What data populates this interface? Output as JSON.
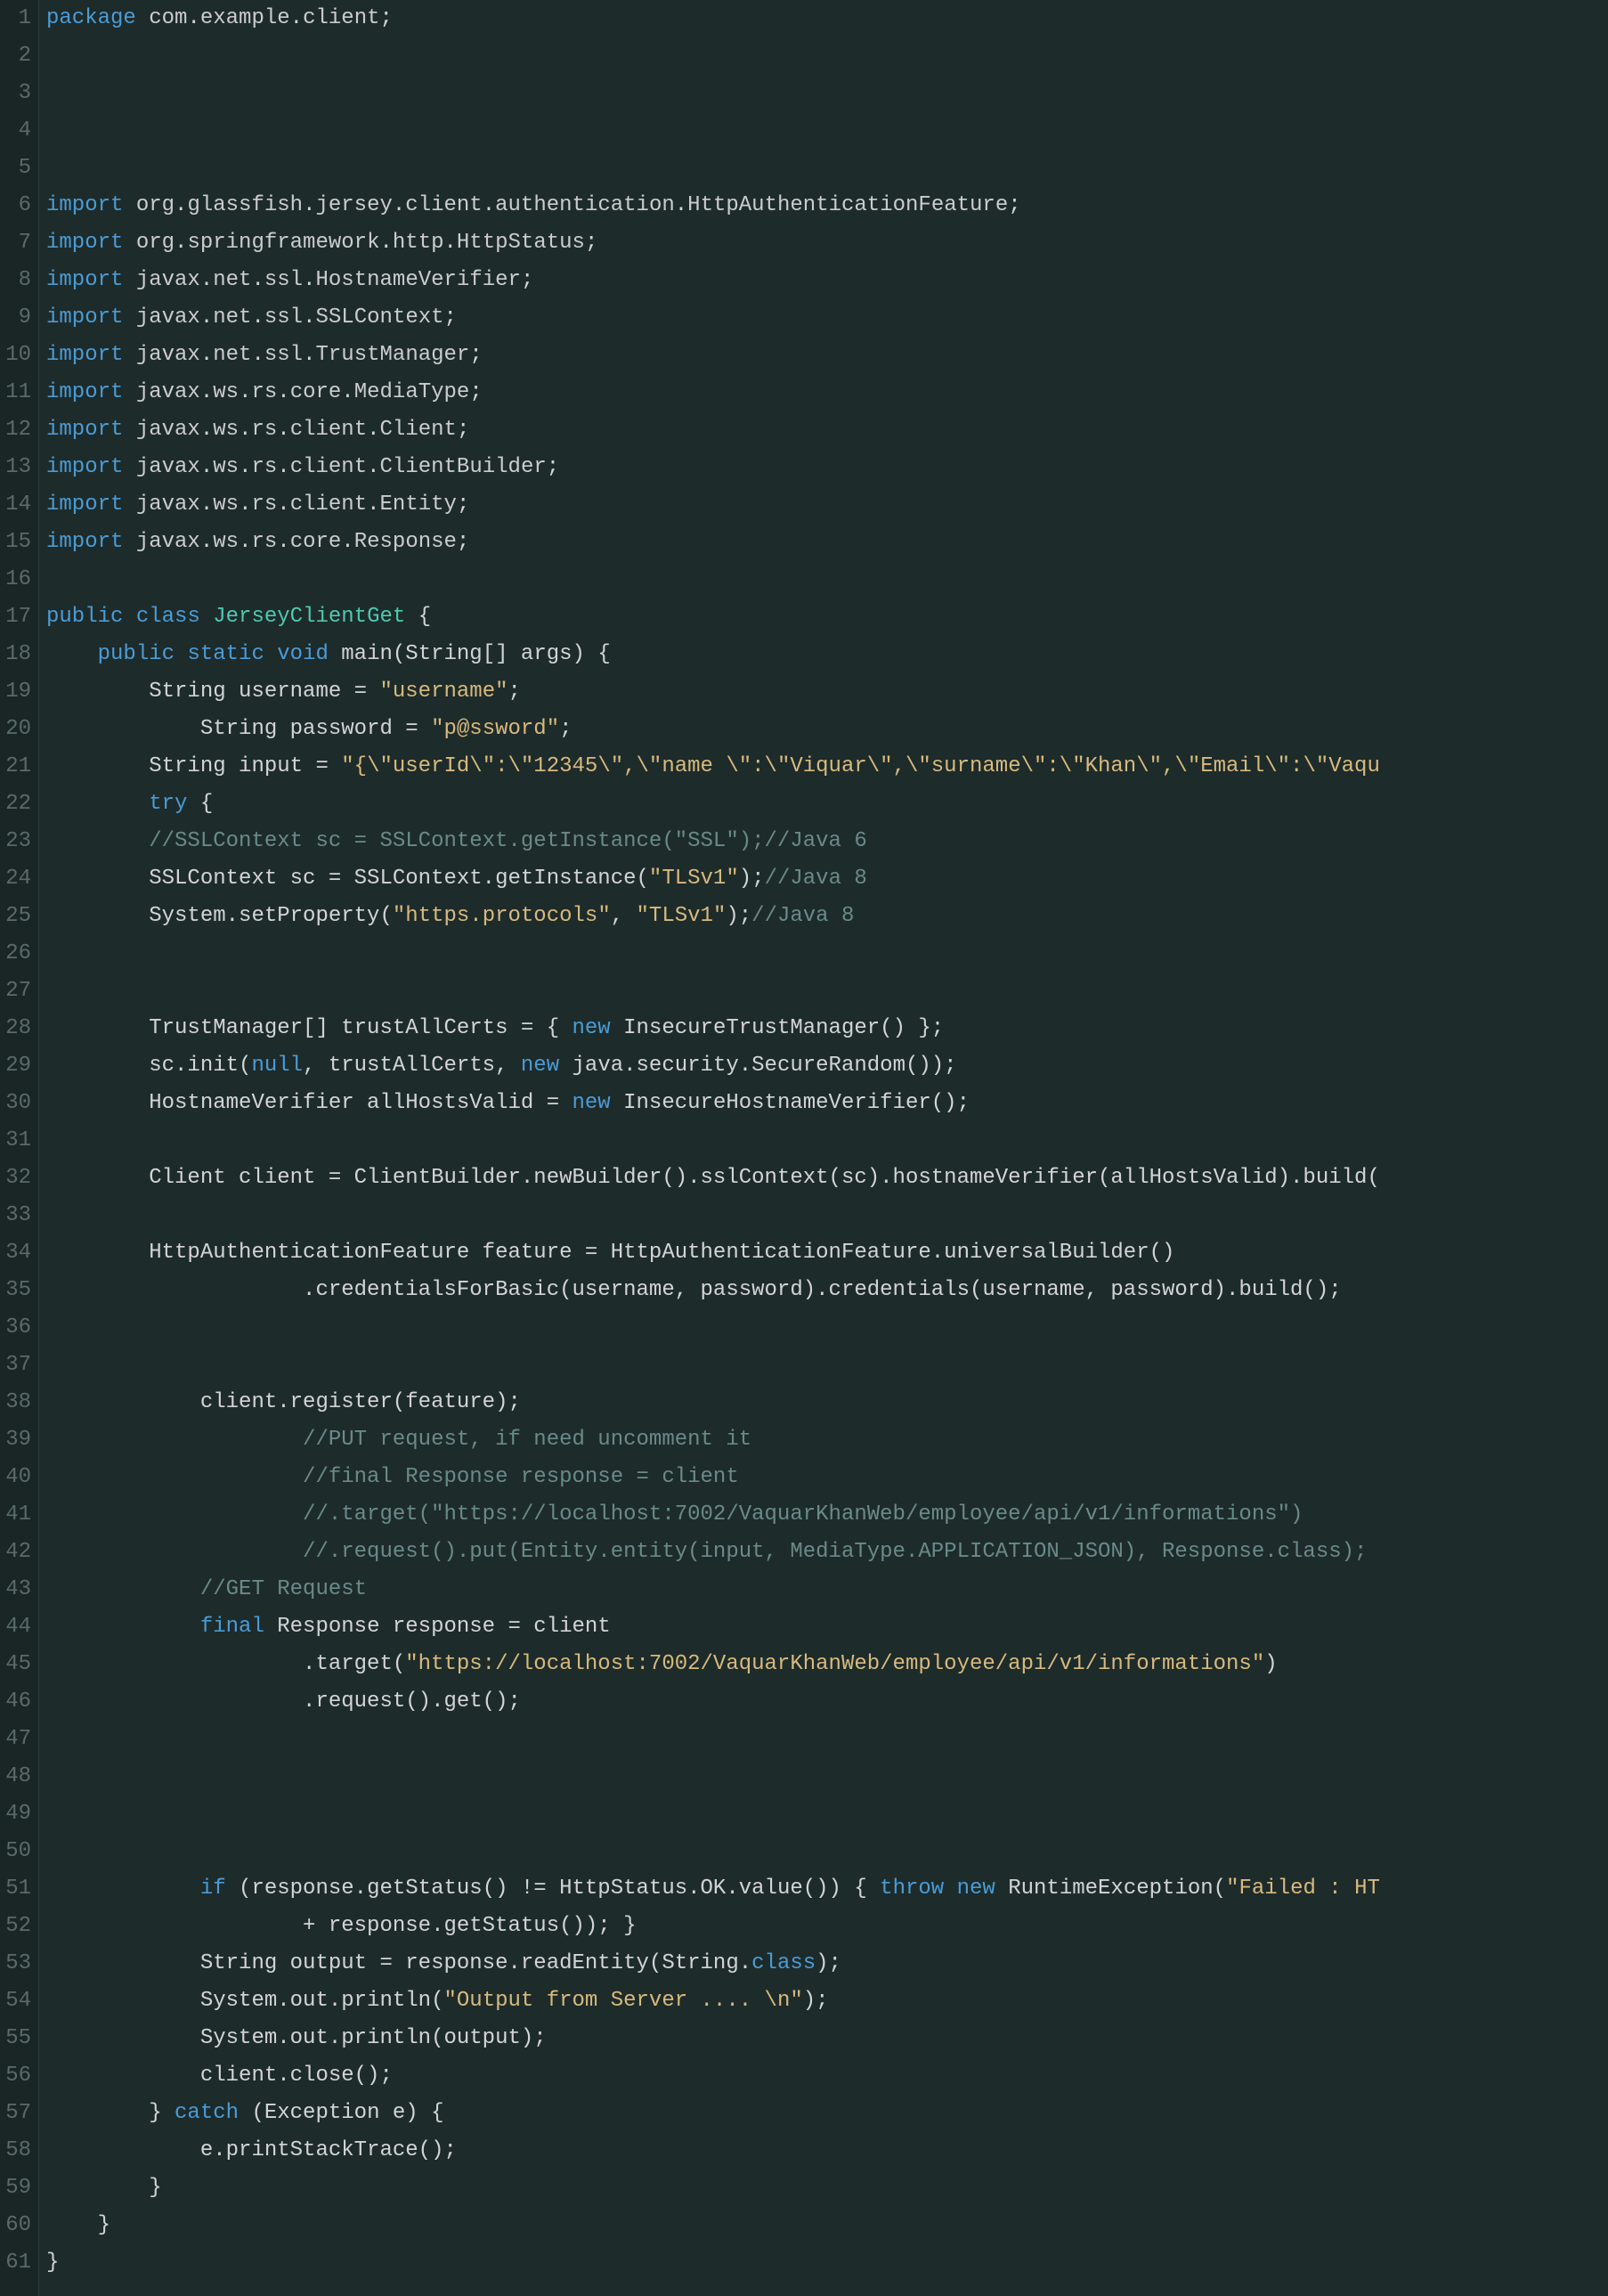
{
  "lines": [
    {
      "n": 1,
      "tokens": [
        [
          "kw",
          "package"
        ],
        [
          "pale",
          " com"
        ],
        [
          "dot",
          "."
        ],
        [
          "pale",
          "example"
        ],
        [
          "dot",
          "."
        ],
        [
          "pale",
          "client"
        ],
        [
          "ident",
          ";"
        ]
      ]
    },
    {
      "n": 2,
      "tokens": []
    },
    {
      "n": 3,
      "tokens": []
    },
    {
      "n": 4,
      "tokens": []
    },
    {
      "n": 5,
      "tokens": []
    },
    {
      "n": 6,
      "tokens": [
        [
          "kw",
          "import"
        ],
        [
          "pale",
          " org"
        ],
        [
          "dot",
          "."
        ],
        [
          "pale",
          "glassfish"
        ],
        [
          "dot",
          "."
        ],
        [
          "pale",
          "jersey"
        ],
        [
          "dot",
          "."
        ],
        [
          "pale",
          "client"
        ],
        [
          "dot",
          "."
        ],
        [
          "pale",
          "authentication"
        ],
        [
          "dot",
          "."
        ],
        [
          "pale",
          "HttpAuthenticationFeature"
        ],
        [
          "ident",
          ";"
        ]
      ]
    },
    {
      "n": 7,
      "tokens": [
        [
          "kw",
          "import"
        ],
        [
          "pale",
          " org"
        ],
        [
          "dot",
          "."
        ],
        [
          "pale",
          "springframework"
        ],
        [
          "dot",
          "."
        ],
        [
          "pale",
          "http"
        ],
        [
          "dot",
          "."
        ],
        [
          "pale",
          "HttpStatus"
        ],
        [
          "ident",
          ";"
        ]
      ]
    },
    {
      "n": 8,
      "tokens": [
        [
          "kw",
          "import"
        ],
        [
          "pale",
          " javax"
        ],
        [
          "dot",
          "."
        ],
        [
          "pale",
          "net"
        ],
        [
          "dot",
          "."
        ],
        [
          "pale",
          "ssl"
        ],
        [
          "dot",
          "."
        ],
        [
          "pale",
          "HostnameVerifier"
        ],
        [
          "ident",
          ";"
        ]
      ]
    },
    {
      "n": 9,
      "tokens": [
        [
          "kw",
          "import"
        ],
        [
          "pale",
          " javax"
        ],
        [
          "dot",
          "."
        ],
        [
          "pale",
          "net"
        ],
        [
          "dot",
          "."
        ],
        [
          "pale",
          "ssl"
        ],
        [
          "dot",
          "."
        ],
        [
          "pale",
          "SSLContext"
        ],
        [
          "ident",
          ";"
        ]
      ]
    },
    {
      "n": 10,
      "tokens": [
        [
          "kw",
          "import"
        ],
        [
          "pale",
          " javax"
        ],
        [
          "dot",
          "."
        ],
        [
          "pale",
          "net"
        ],
        [
          "dot",
          "."
        ],
        [
          "pale",
          "ssl"
        ],
        [
          "dot",
          "."
        ],
        [
          "pale",
          "TrustManager"
        ],
        [
          "ident",
          ";"
        ]
      ]
    },
    {
      "n": 11,
      "tokens": [
        [
          "kw",
          "import"
        ],
        [
          "pale",
          " javax"
        ],
        [
          "dot",
          "."
        ],
        [
          "pale",
          "ws"
        ],
        [
          "dot",
          "."
        ],
        [
          "pale",
          "rs"
        ],
        [
          "dot",
          "."
        ],
        [
          "pale",
          "core"
        ],
        [
          "dot",
          "."
        ],
        [
          "pale",
          "MediaType"
        ],
        [
          "ident",
          ";"
        ]
      ]
    },
    {
      "n": 12,
      "tokens": [
        [
          "kw",
          "import"
        ],
        [
          "pale",
          " javax"
        ],
        [
          "dot",
          "."
        ],
        [
          "pale",
          "ws"
        ],
        [
          "dot",
          "."
        ],
        [
          "pale",
          "rs"
        ],
        [
          "dot",
          "."
        ],
        [
          "pale",
          "client"
        ],
        [
          "dot",
          "."
        ],
        [
          "pale",
          "Client"
        ],
        [
          "ident",
          ";"
        ]
      ]
    },
    {
      "n": 13,
      "tokens": [
        [
          "kw",
          "import"
        ],
        [
          "pale",
          " javax"
        ],
        [
          "dot",
          "."
        ],
        [
          "pale",
          "ws"
        ],
        [
          "dot",
          "."
        ],
        [
          "pale",
          "rs"
        ],
        [
          "dot",
          "."
        ],
        [
          "pale",
          "client"
        ],
        [
          "dot",
          "."
        ],
        [
          "pale",
          "ClientBuilder"
        ],
        [
          "ident",
          ";"
        ]
      ]
    },
    {
      "n": 14,
      "tokens": [
        [
          "kw",
          "import"
        ],
        [
          "pale",
          " javax"
        ],
        [
          "dot",
          "."
        ],
        [
          "pale",
          "ws"
        ],
        [
          "dot",
          "."
        ],
        [
          "pale",
          "rs"
        ],
        [
          "dot",
          "."
        ],
        [
          "pale",
          "client"
        ],
        [
          "dot",
          "."
        ],
        [
          "pale",
          "Entity"
        ],
        [
          "ident",
          ";"
        ]
      ]
    },
    {
      "n": 15,
      "tokens": [
        [
          "kw",
          "import"
        ],
        [
          "pale",
          " javax"
        ],
        [
          "dot",
          "."
        ],
        [
          "pale",
          "ws"
        ],
        [
          "dot",
          "."
        ],
        [
          "pale",
          "rs"
        ],
        [
          "dot",
          "."
        ],
        [
          "pale",
          "core"
        ],
        [
          "dot",
          "."
        ],
        [
          "pale",
          "Response"
        ],
        [
          "ident",
          ";"
        ]
      ]
    },
    {
      "n": 16,
      "tokens": []
    },
    {
      "n": 17,
      "tokens": [
        [
          "kw",
          "public"
        ],
        [
          "ident",
          " "
        ],
        [
          "kw",
          "class"
        ],
        [
          "ident",
          " "
        ],
        [
          "type",
          "JerseyClientGet"
        ],
        [
          "ident",
          " {"
        ]
      ]
    },
    {
      "n": 18,
      "tokens": [
        [
          "ident",
          "    "
        ],
        [
          "kw",
          "public"
        ],
        [
          "ident",
          " "
        ],
        [
          "kw",
          "static"
        ],
        [
          "ident",
          " "
        ],
        [
          "kw",
          "void"
        ],
        [
          "ident",
          " main(String[] args) {"
        ]
      ]
    },
    {
      "n": 19,
      "tokens": [
        [
          "ident",
          "        String username = "
        ],
        [
          "str",
          "\"username\""
        ],
        [
          "ident",
          ";"
        ]
      ]
    },
    {
      "n": 20,
      "tokens": [
        [
          "ident",
          "            String password = "
        ],
        [
          "str",
          "\"p@ssword\""
        ],
        [
          "ident",
          ";"
        ]
      ]
    },
    {
      "n": 21,
      "tokens": [
        [
          "ident",
          "        String input = "
        ],
        [
          "str",
          "\"{\\\"userId\\\":\\\"12345\\\",\\\"name \\\":\\\"Viquar\\\",\\\"surname\\\":\\\"Khan\\\",\\\"Email\\\":\\\"Vaqu"
        ]
      ]
    },
    {
      "n": 22,
      "tokens": [
        [
          "ident",
          "        "
        ],
        [
          "kw",
          "try"
        ],
        [
          "ident",
          " {"
        ]
      ]
    },
    {
      "n": 23,
      "tokens": [
        [
          "ident",
          "        "
        ],
        [
          "cmt",
          "//SSLContext sc = SSLContext.getInstance(\"SSL\");//Java 6"
        ]
      ]
    },
    {
      "n": 24,
      "tokens": [
        [
          "ident",
          "        SSLContext sc = SSLContext.getInstance("
        ],
        [
          "str",
          "\"TLSv1\""
        ],
        [
          "ident",
          ");"
        ],
        [
          "cmt",
          "//Java 8"
        ]
      ]
    },
    {
      "n": 25,
      "tokens": [
        [
          "ident",
          "        System.setProperty("
        ],
        [
          "str",
          "\"https.protocols\""
        ],
        [
          "ident",
          ", "
        ],
        [
          "str",
          "\"TLSv1\""
        ],
        [
          "ident",
          ");"
        ],
        [
          "cmt",
          "//Java 8"
        ]
      ]
    },
    {
      "n": 26,
      "tokens": []
    },
    {
      "n": 27,
      "tokens": []
    },
    {
      "n": 28,
      "tokens": [
        [
          "ident",
          "        TrustManager[] trustAllCerts = { "
        ],
        [
          "kw",
          "new"
        ],
        [
          "ident",
          " InsecureTrustManager() };"
        ]
      ]
    },
    {
      "n": 29,
      "tokens": [
        [
          "ident",
          "        sc.init("
        ],
        [
          "kw",
          "null"
        ],
        [
          "ident",
          ", trustAllCerts, "
        ],
        [
          "kw",
          "new"
        ],
        [
          "ident",
          " java.security.SecureRandom());"
        ]
      ]
    },
    {
      "n": 30,
      "tokens": [
        [
          "ident",
          "        HostnameVerifier allHostsValid = "
        ],
        [
          "kw",
          "new"
        ],
        [
          "ident",
          " InsecureHostnameVerifier();"
        ]
      ]
    },
    {
      "n": 31,
      "tokens": []
    },
    {
      "n": 32,
      "tokens": [
        [
          "ident",
          "        Client client = ClientBuilder.newBuilder().sslContext(sc).hostnameVerifier(allHostsValid).build("
        ]
      ]
    },
    {
      "n": 33,
      "tokens": []
    },
    {
      "n": 34,
      "tokens": [
        [
          "ident",
          "        HttpAuthenticationFeature feature = HttpAuthenticationFeature.universalBuilder()"
        ]
      ]
    },
    {
      "n": 35,
      "tokens": [
        [
          "ident",
          "                    .credentialsForBasic(username, password).credentials(username, password).build();"
        ]
      ]
    },
    {
      "n": 36,
      "tokens": []
    },
    {
      "n": 37,
      "tokens": []
    },
    {
      "n": 38,
      "tokens": [
        [
          "ident",
          "            client.register(feature);"
        ]
      ]
    },
    {
      "n": 39,
      "tokens": [
        [
          "ident",
          "                    "
        ],
        [
          "cmt",
          "//PUT request, if need uncomment it "
        ]
      ]
    },
    {
      "n": 40,
      "tokens": [
        [
          "ident",
          "                    "
        ],
        [
          "cmt",
          "//final Response response = client"
        ]
      ]
    },
    {
      "n": 41,
      "tokens": [
        [
          "ident",
          "                    "
        ],
        [
          "cmt",
          "//.target(\"https://localhost:7002/VaquarKhanWeb/employee/api/v1/informations\")"
        ]
      ]
    },
    {
      "n": 42,
      "tokens": [
        [
          "ident",
          "                    "
        ],
        [
          "cmt",
          "//.request().put(Entity.entity(input, MediaType.APPLICATION_JSON), Response.class);"
        ]
      ]
    },
    {
      "n": 43,
      "tokens": [
        [
          "ident",
          "            "
        ],
        [
          "cmt",
          "//GET Request "
        ]
      ]
    },
    {
      "n": 44,
      "tokens": [
        [
          "ident",
          "            "
        ],
        [
          "kw",
          "final"
        ],
        [
          "ident",
          " Response response = client"
        ]
      ]
    },
    {
      "n": 45,
      "tokens": [
        [
          "ident",
          "                    .target("
        ],
        [
          "str",
          "\"https://localhost:7002/VaquarKhanWeb/employee/api/v1/informations\""
        ],
        [
          "ident",
          ")"
        ]
      ]
    },
    {
      "n": 46,
      "tokens": [
        [
          "ident",
          "                    .request().get();"
        ]
      ]
    },
    {
      "n": 47,
      "tokens": []
    },
    {
      "n": 48,
      "tokens": []
    },
    {
      "n": 49,
      "tokens": []
    },
    {
      "n": 50,
      "tokens": []
    },
    {
      "n": 51,
      "tokens": [
        [
          "ident",
          "            "
        ],
        [
          "kw",
          "if"
        ],
        [
          "ident",
          " (response.getStatus() != HttpStatus.OK.value()) { "
        ],
        [
          "kw",
          "throw"
        ],
        [
          "ident",
          " "
        ],
        [
          "kw",
          "new"
        ],
        [
          "ident",
          " RuntimeException("
        ],
        [
          "str",
          "\"Failed : HT"
        ]
      ]
    },
    {
      "n": 52,
      "tokens": [
        [
          "ident",
          "                    + response.getStatus()); }"
        ]
      ]
    },
    {
      "n": 53,
      "tokens": [
        [
          "ident",
          "            String output = response.readEntity(String."
        ],
        [
          "kw",
          "class"
        ],
        [
          "ident",
          ");"
        ]
      ]
    },
    {
      "n": 54,
      "tokens": [
        [
          "ident",
          "            System.out.println("
        ],
        [
          "str",
          "\"Output from Server .... \\n\""
        ],
        [
          "ident",
          ");"
        ]
      ]
    },
    {
      "n": 55,
      "tokens": [
        [
          "ident",
          "            System.out.println(output);"
        ]
      ]
    },
    {
      "n": 56,
      "tokens": [
        [
          "ident",
          "            client.close();"
        ]
      ]
    },
    {
      "n": 57,
      "tokens": [
        [
          "ident",
          "        } "
        ],
        [
          "kw",
          "catch"
        ],
        [
          "ident",
          " (Exception e) {"
        ]
      ]
    },
    {
      "n": 58,
      "tokens": [
        [
          "ident",
          "            e.printStackTrace();"
        ]
      ]
    },
    {
      "n": 59,
      "tokens": [
        [
          "ident",
          "        }"
        ]
      ]
    },
    {
      "n": 60,
      "tokens": [
        [
          "ident",
          "    }"
        ]
      ]
    },
    {
      "n": 61,
      "tokens": [
        [
          "ident",
          "}"
        ]
      ]
    }
  ]
}
